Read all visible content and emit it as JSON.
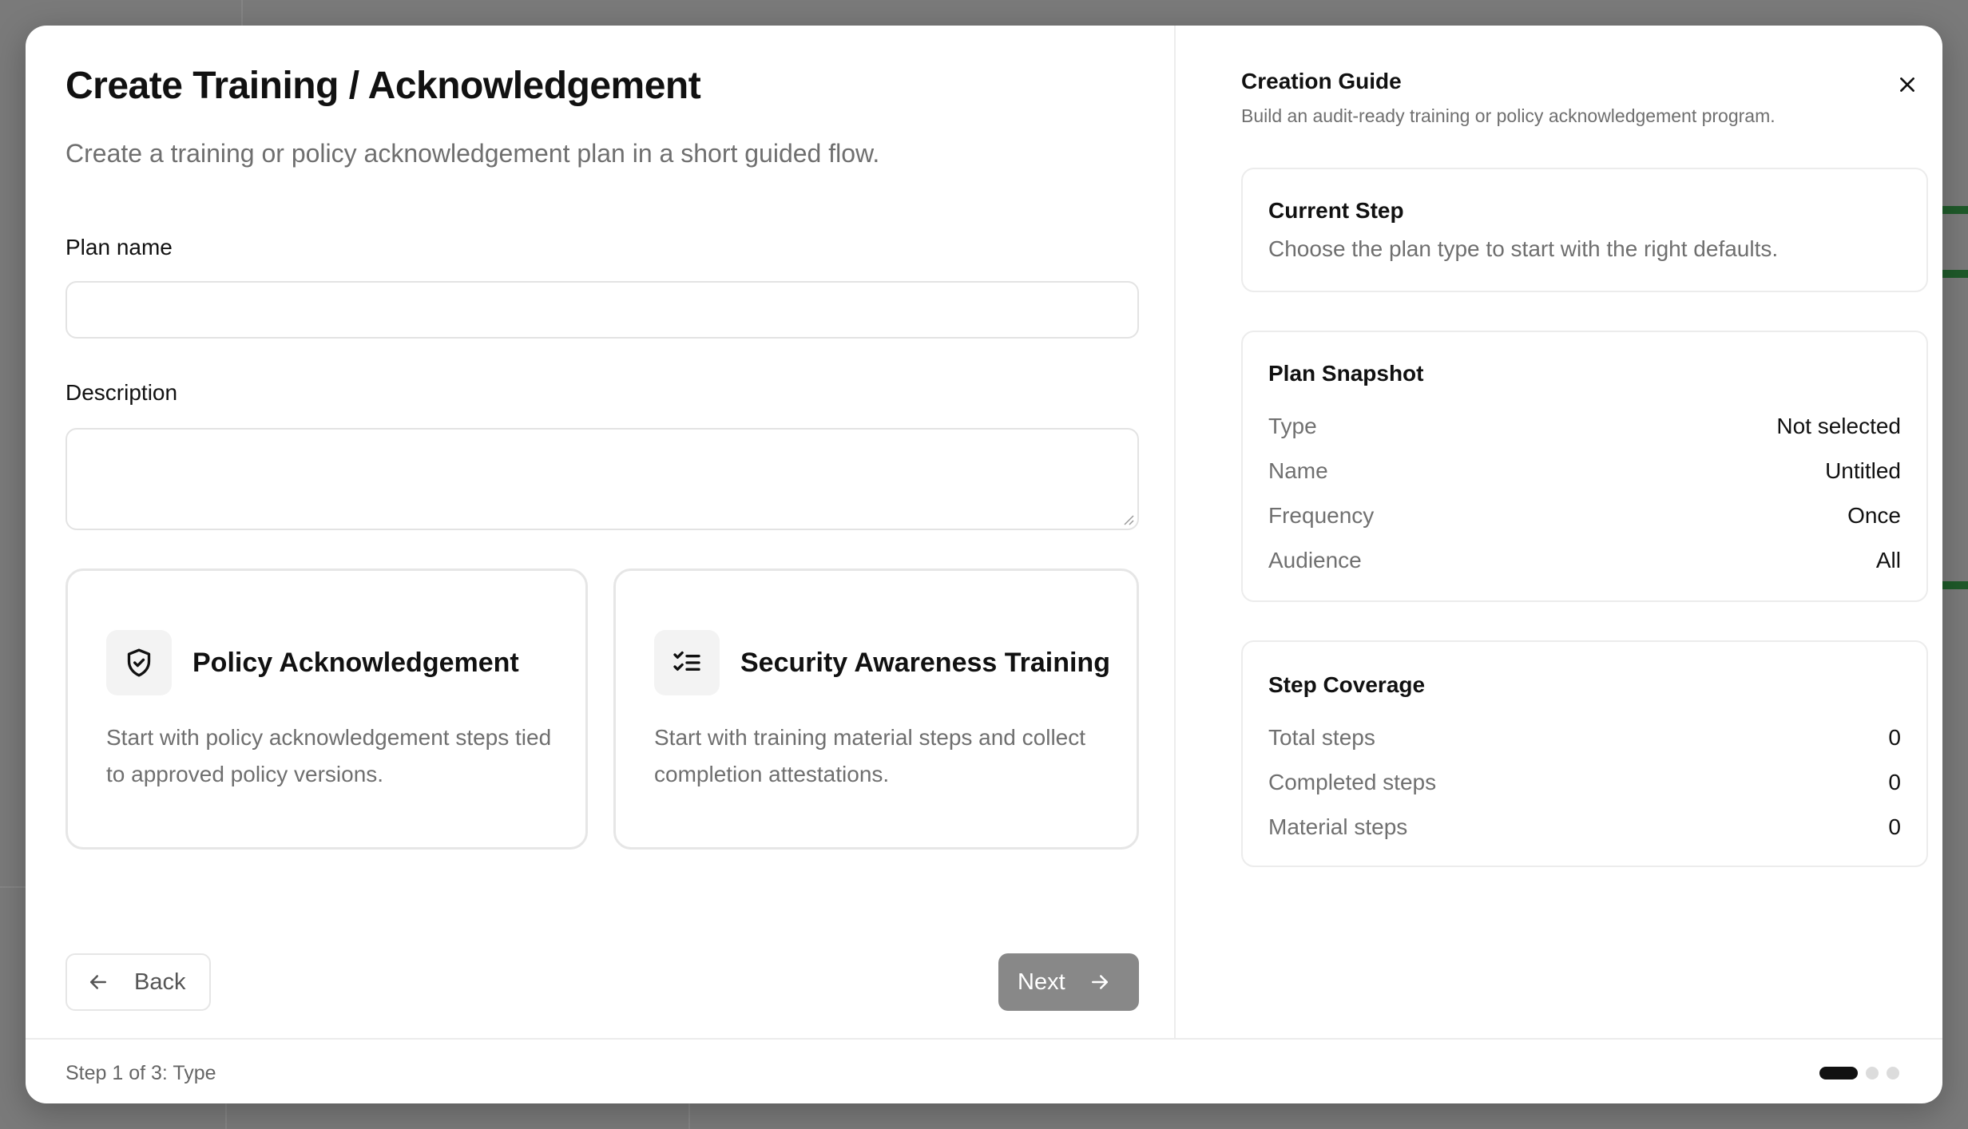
{
  "dialog": {
    "title": "Create Training / Acknowledgement",
    "subtitle": "Create a training or policy acknowledgement plan in a short guided flow."
  },
  "form": {
    "plan_name_label": "Plan name",
    "plan_name_value": "",
    "description_label": "Description",
    "description_value": ""
  },
  "plan_types": [
    {
      "title": "Policy Acknowledgement",
      "description": "Start with policy acknowledgement steps tied to approved policy versions.",
      "icon": "shield-check-icon"
    },
    {
      "title": "Security Awareness Training",
      "description": "Start with training material steps and collect completion attestations.",
      "icon": "list-checks-icon"
    }
  ],
  "navigation": {
    "back_label": "Back",
    "next_label": "Next"
  },
  "guide": {
    "title": "Creation Guide",
    "subtitle": "Build an audit-ready training or policy acknowledgement program.",
    "current_step": {
      "heading": "Current Step",
      "text": "Choose the plan type to start with the right defaults."
    },
    "snapshot": {
      "heading": "Plan Snapshot",
      "rows": [
        {
          "key": "Type",
          "value": "Not selected"
        },
        {
          "key": "Name",
          "value": "Untitled"
        },
        {
          "key": "Frequency",
          "value": "Once"
        },
        {
          "key": "Audience",
          "value": "All"
        }
      ]
    },
    "coverage": {
      "heading": "Step Coverage",
      "rows": [
        {
          "key": "Total steps",
          "value": "0"
        },
        {
          "key": "Completed steps",
          "value": "0"
        },
        {
          "key": "Material steps",
          "value": "0"
        }
      ]
    }
  },
  "footer": {
    "step_text": "Step 1 of 3: Type",
    "current_step": 1,
    "total_steps": 3
  },
  "colors": {
    "next_button_bg": "#888888",
    "active_dot": "#111111",
    "inactive_dot": "#dcdcdc"
  }
}
